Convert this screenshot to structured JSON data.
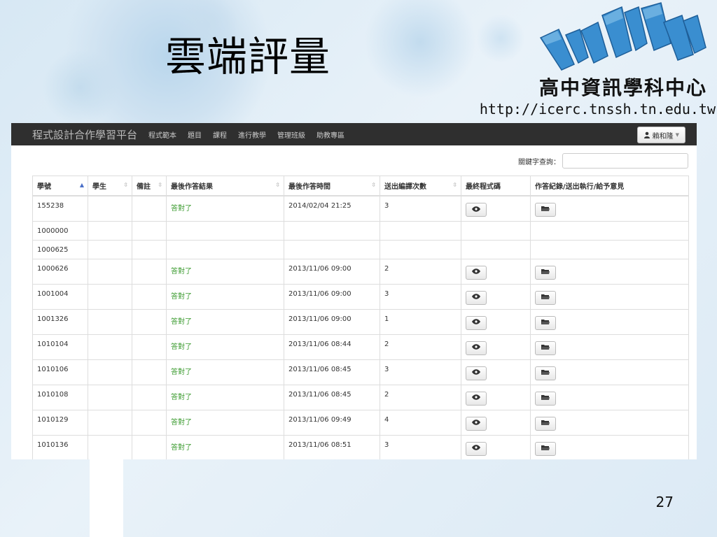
{
  "slide": {
    "title": "雲端評量",
    "center_name": "高中資訊學科中心",
    "center_url": "http://icerc.tnssh.tn.edu.tw",
    "page_number": "27"
  },
  "navbar": {
    "brand": "程式設計合作學習平台",
    "links": [
      "程式範本",
      "題目",
      "課程",
      "進行教學",
      "管理班級",
      "助教專區"
    ],
    "user": "賴和隆"
  },
  "search": {
    "label": "關鍵字查詢：",
    "value": "",
    "placeholder": ""
  },
  "table": {
    "headers": [
      "學號",
      "學生",
      "備註",
      "最後作答結果",
      "最後作答時間",
      "送出編譯次數",
      "最終程式碼",
      "作答紀錄/送出執行/給予意見"
    ],
    "rows": [
      {
        "id": "155238",
        "student": "",
        "note": "",
        "result": "答對了",
        "time": "2014/02/04 21:25",
        "compiles": "3",
        "buttons": true
      },
      {
        "id": "1000000",
        "student": "",
        "note": "",
        "result": "",
        "time": "",
        "compiles": "",
        "buttons": false
      },
      {
        "id": "1000625",
        "student": "",
        "note": "",
        "result": "",
        "time": "",
        "compiles": "",
        "buttons": false
      },
      {
        "id": "1000626",
        "student": "",
        "note": "",
        "result": "答對了",
        "time": "2013/11/06 09:00",
        "compiles": "2",
        "buttons": true
      },
      {
        "id": "1001004",
        "student": "",
        "note": "",
        "result": "答對了",
        "time": "2013/11/06 09:00",
        "compiles": "3",
        "buttons": true
      },
      {
        "id": "1001326",
        "student": "",
        "note": "",
        "result": "答對了",
        "time": "2013/11/06 09:00",
        "compiles": "1",
        "buttons": true
      },
      {
        "id": "1010104",
        "student": "",
        "note": "",
        "result": "答對了",
        "time": "2013/11/06 08:44",
        "compiles": "2",
        "buttons": true
      },
      {
        "id": "1010106",
        "student": "",
        "note": "",
        "result": "答對了",
        "time": "2013/11/06 08:45",
        "compiles": "3",
        "buttons": true
      },
      {
        "id": "1010108",
        "student": "",
        "note": "",
        "result": "答對了",
        "time": "2013/11/06 08:45",
        "compiles": "2",
        "buttons": true
      },
      {
        "id": "1010129",
        "student": "",
        "note": "",
        "result": "答對了",
        "time": "2013/11/06 09:49",
        "compiles": "4",
        "buttons": true
      },
      {
        "id": "1010136",
        "student": "",
        "note": "",
        "result": "答對了",
        "time": "2013/11/06 08:51",
        "compiles": "3",
        "buttons": true
      }
    ]
  },
  "icons": {
    "view_code": "eye-icon",
    "record": "folder-open-icon",
    "user": "user-icon",
    "sort_asc": "sort-asc-icon",
    "sort": "sort-icon"
  },
  "colors": {
    "navbar": "#2f2f2f",
    "success_text": "#3a9a2e",
    "www_logo": "#3a8ed0"
  }
}
